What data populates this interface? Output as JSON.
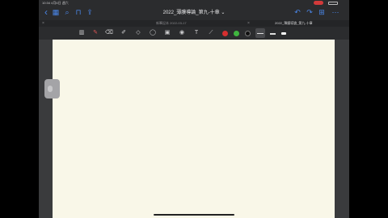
{
  "status": {
    "time": "10:34",
    "date": "4月6日 週六"
  },
  "title": "2022_薄膜導論_第九-十章",
  "title_chevron": "⌄",
  "tabs": [
    {
      "label": "新筆記本 2022-03-17",
      "active": false
    },
    {
      "label": "2022_薄膜導論_第九-十章",
      "active": true
    }
  ],
  "icons": {
    "back": "‹",
    "grid": "▦",
    "search": "⌕",
    "bookmark": "⊓",
    "share": "⇪",
    "undo": "↶",
    "redo": "↷",
    "add_page": "⊞",
    "more": "⋯"
  },
  "toolbar": {
    "tools": [
      "reader",
      "pen",
      "eraser",
      "highlighter",
      "shapes",
      "lasso",
      "image",
      "camera",
      "text",
      "laser"
    ],
    "colors": [
      "#d62f2f",
      "#3fb53f",
      "#111111"
    ],
    "line_widths": [
      "thin",
      "thick"
    ]
  }
}
